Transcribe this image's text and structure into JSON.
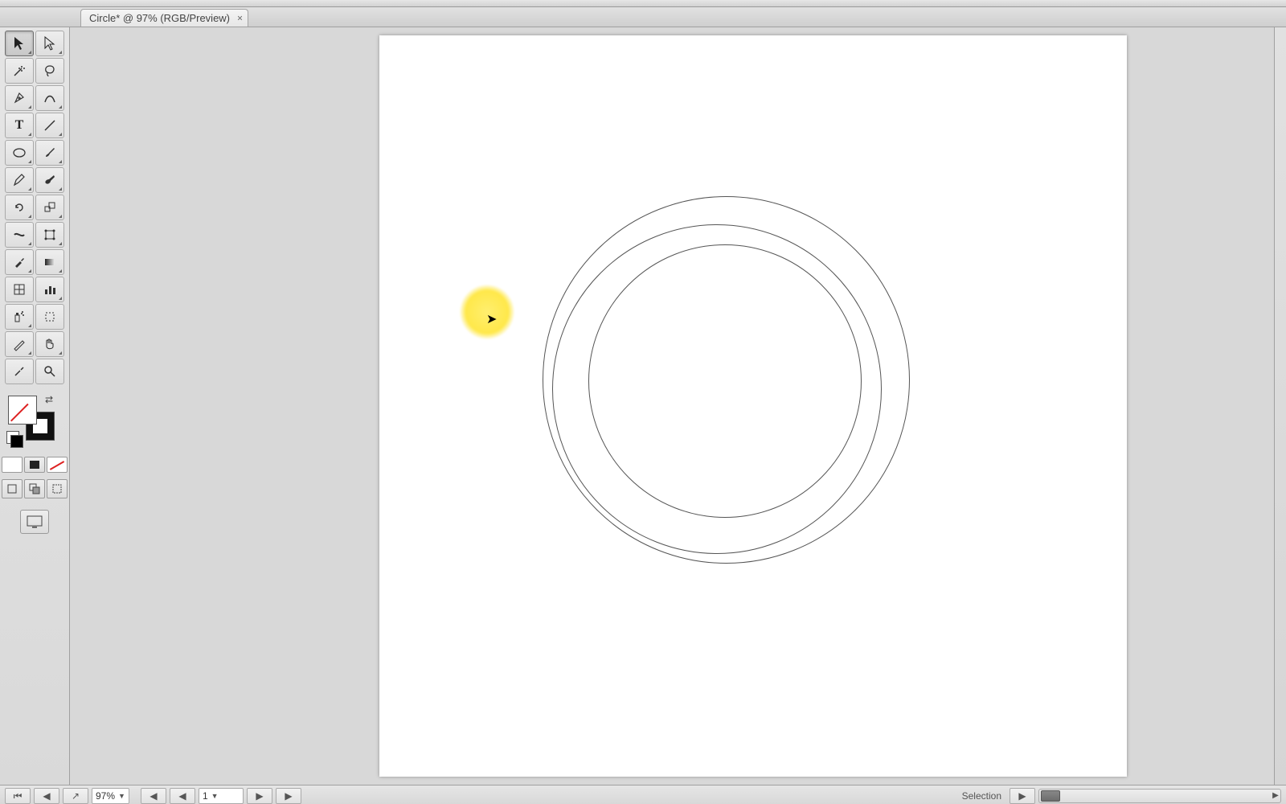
{
  "document": {
    "tab_title": "Circle* @ 97% (RGB/Preview)"
  },
  "status": {
    "zoom_value": "97%",
    "page_value": "1",
    "tool_label": "Selection"
  },
  "tools": {
    "selection": "Selection Tool",
    "direct_selection": "Direct Selection Tool",
    "magic_wand": "Magic Wand Tool",
    "lasso": "Lasso Tool",
    "pen": "Pen Tool",
    "curvature": "Curvature Tool",
    "type": "Type Tool",
    "line": "Line Segment Tool",
    "ellipse": "Ellipse Tool",
    "paintbrush": "Paintbrush Tool",
    "pencil": "Pencil Tool",
    "blob_brush": "Blob Brush Tool",
    "rotate": "Rotate Tool",
    "scale": "Scale Tool",
    "width": "Width Tool",
    "free_transform": "Free Transform Tool",
    "eyedropper": "Eyedropper Tool",
    "gradient": "Gradient Tool",
    "mesh": "Mesh Tool",
    "graph": "Column Graph Tool",
    "symbol_sprayer": "Symbol Sprayer Tool",
    "artboard": "Artboard Tool",
    "slice": "Slice Tool",
    "hand": "Hand Tool",
    "zoom": "Zoom Tool"
  },
  "color": {
    "fill": "none",
    "stroke": "#000000"
  }
}
